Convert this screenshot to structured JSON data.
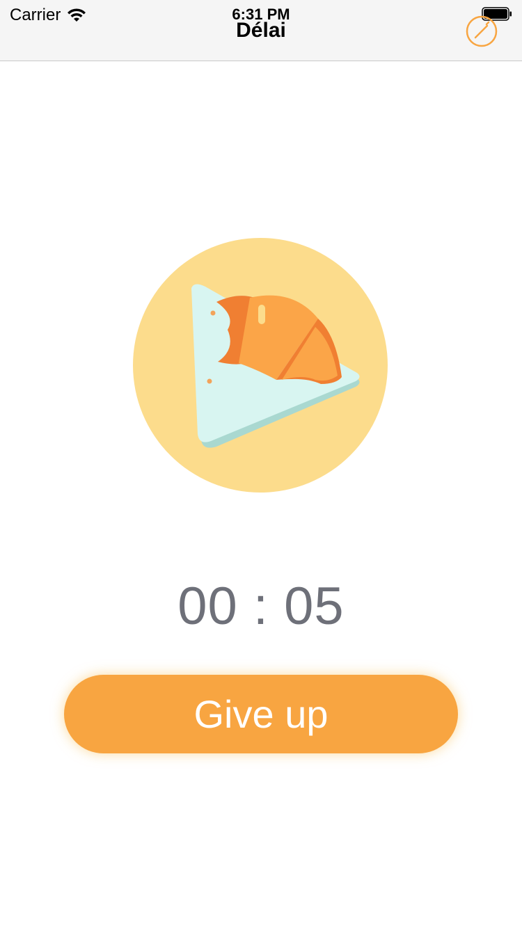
{
  "status_bar": {
    "carrier": "Carrier",
    "time": "6:31 PM"
  },
  "nav": {
    "title": "Délai",
    "edit_icon": "pencil-circle-icon"
  },
  "illustration": {
    "icon": "croissant-on-plate-icon",
    "colors": {
      "circle": "#fcdc8c",
      "plate": "#d8f5f1",
      "plate_shadow": "#a9d8d0",
      "croissant_light": "#fba548",
      "croissant_dark": "#f07f32"
    }
  },
  "timer": {
    "display": "00 : 05"
  },
  "actions": {
    "give_up_label": "Give up"
  },
  "colors": {
    "accent": "#f8a541",
    "timer_text": "#6e7079",
    "nav_background": "#f5f5f5"
  }
}
